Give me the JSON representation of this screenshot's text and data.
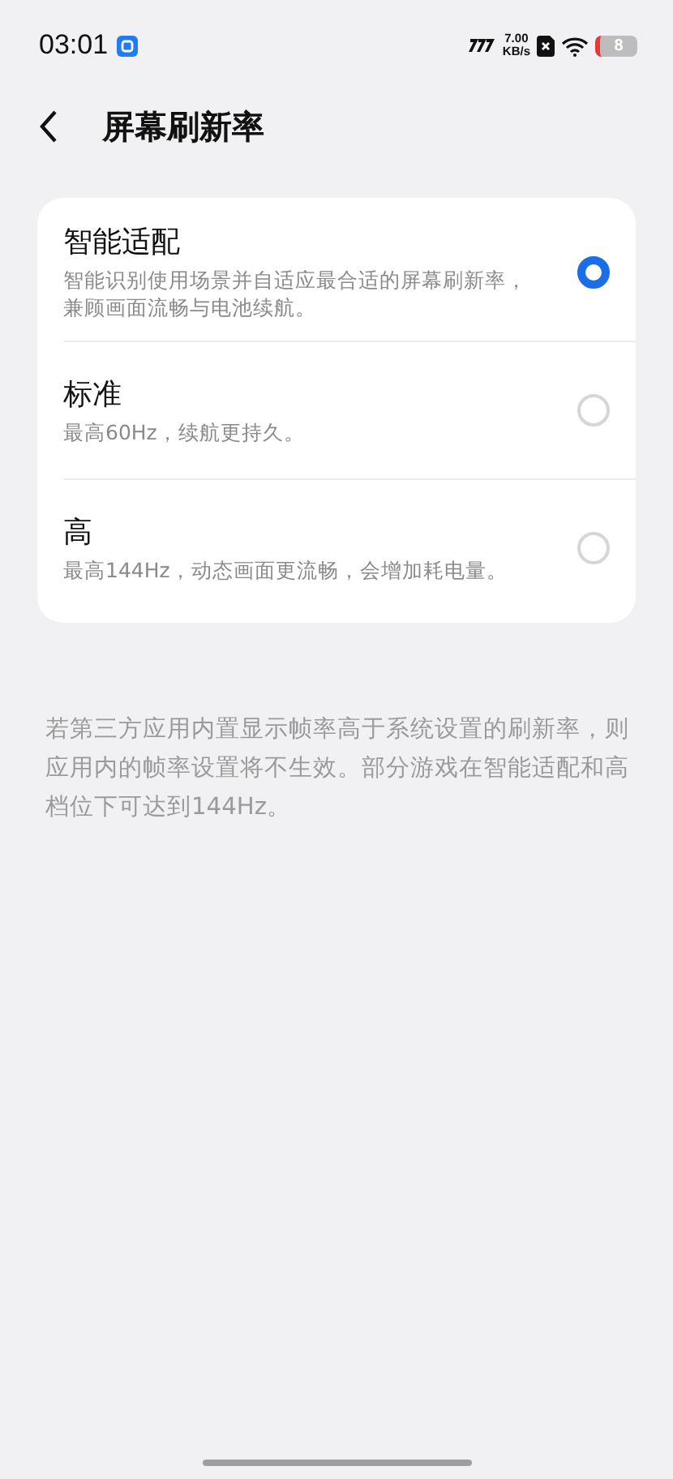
{
  "status_bar": {
    "time": "03:01",
    "speed_value": "7.00",
    "speed_unit": "KB/s",
    "battery": "8"
  },
  "header": {
    "title": "屏幕刷新率"
  },
  "options": [
    {
      "label": "智能适配",
      "description": "智能识别使用场景并自适应最合适的屏幕刷新率，兼顾画面流畅与电池续航。",
      "selected": true
    },
    {
      "label": "标准",
      "description": "最高60Hz，续航更持久。",
      "selected": false
    },
    {
      "label": "高",
      "description": "最高144Hz，动态画面更流畅，会增加耗电量。",
      "selected": false
    }
  ],
  "footnote": "若第三方应用内置显示帧率高于系统设置的刷新率，则应用内的帧率设置将不生效。部分游戏在智能适配和高档位下可达到144Hz。"
}
